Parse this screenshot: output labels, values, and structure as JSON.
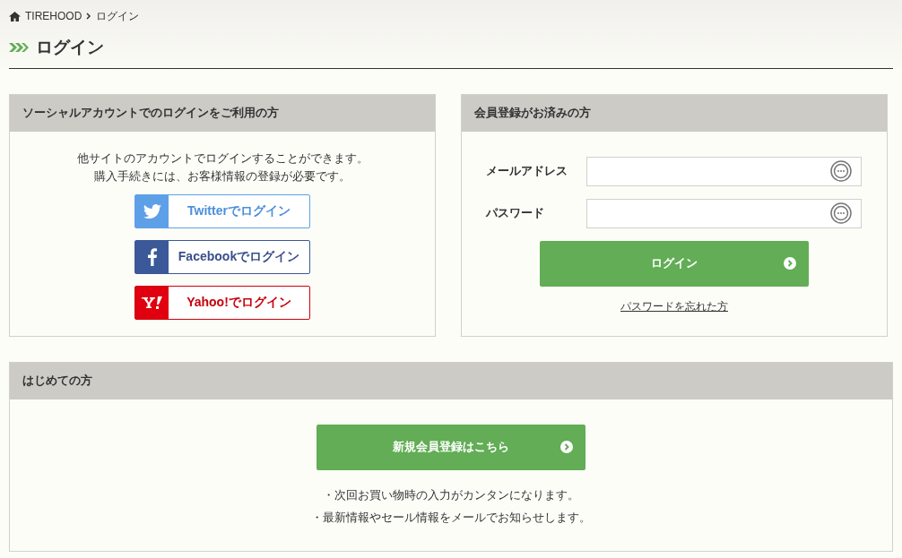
{
  "breadcrumb": {
    "items": [
      "TIREHOOD",
      "ログイン"
    ]
  },
  "page_title": "ログイン",
  "social_panel": {
    "title": "ソーシャルアカウントでのログインをご利用の方",
    "description": [
      "他サイトのアカウントでログインすることができます。",
      "購入手続きには、お客様情報の登録が必要です。"
    ],
    "buttons": [
      {
        "kind": "twitter",
        "label": "Twitterでログイン"
      },
      {
        "kind": "facebook",
        "label": "Facebookでログイン"
      },
      {
        "kind": "yahoo",
        "label": "Yahoo!でログイン"
      }
    ]
  },
  "member_panel": {
    "title": "会員登録がお済みの方",
    "fields": [
      {
        "label": "メールアドレス"
      },
      {
        "label": "パスワード"
      }
    ],
    "login_button": "ログイン",
    "forgot_link": "パスワードを忘れた方"
  },
  "new_panel": {
    "title": "はじめての方",
    "register_button": "新規会員登録はこちら",
    "benefits": [
      "・次回お買い物時の入力がカンタンになります。",
      "・最新情報やセール情報をメールでお知らせします。"
    ]
  }
}
